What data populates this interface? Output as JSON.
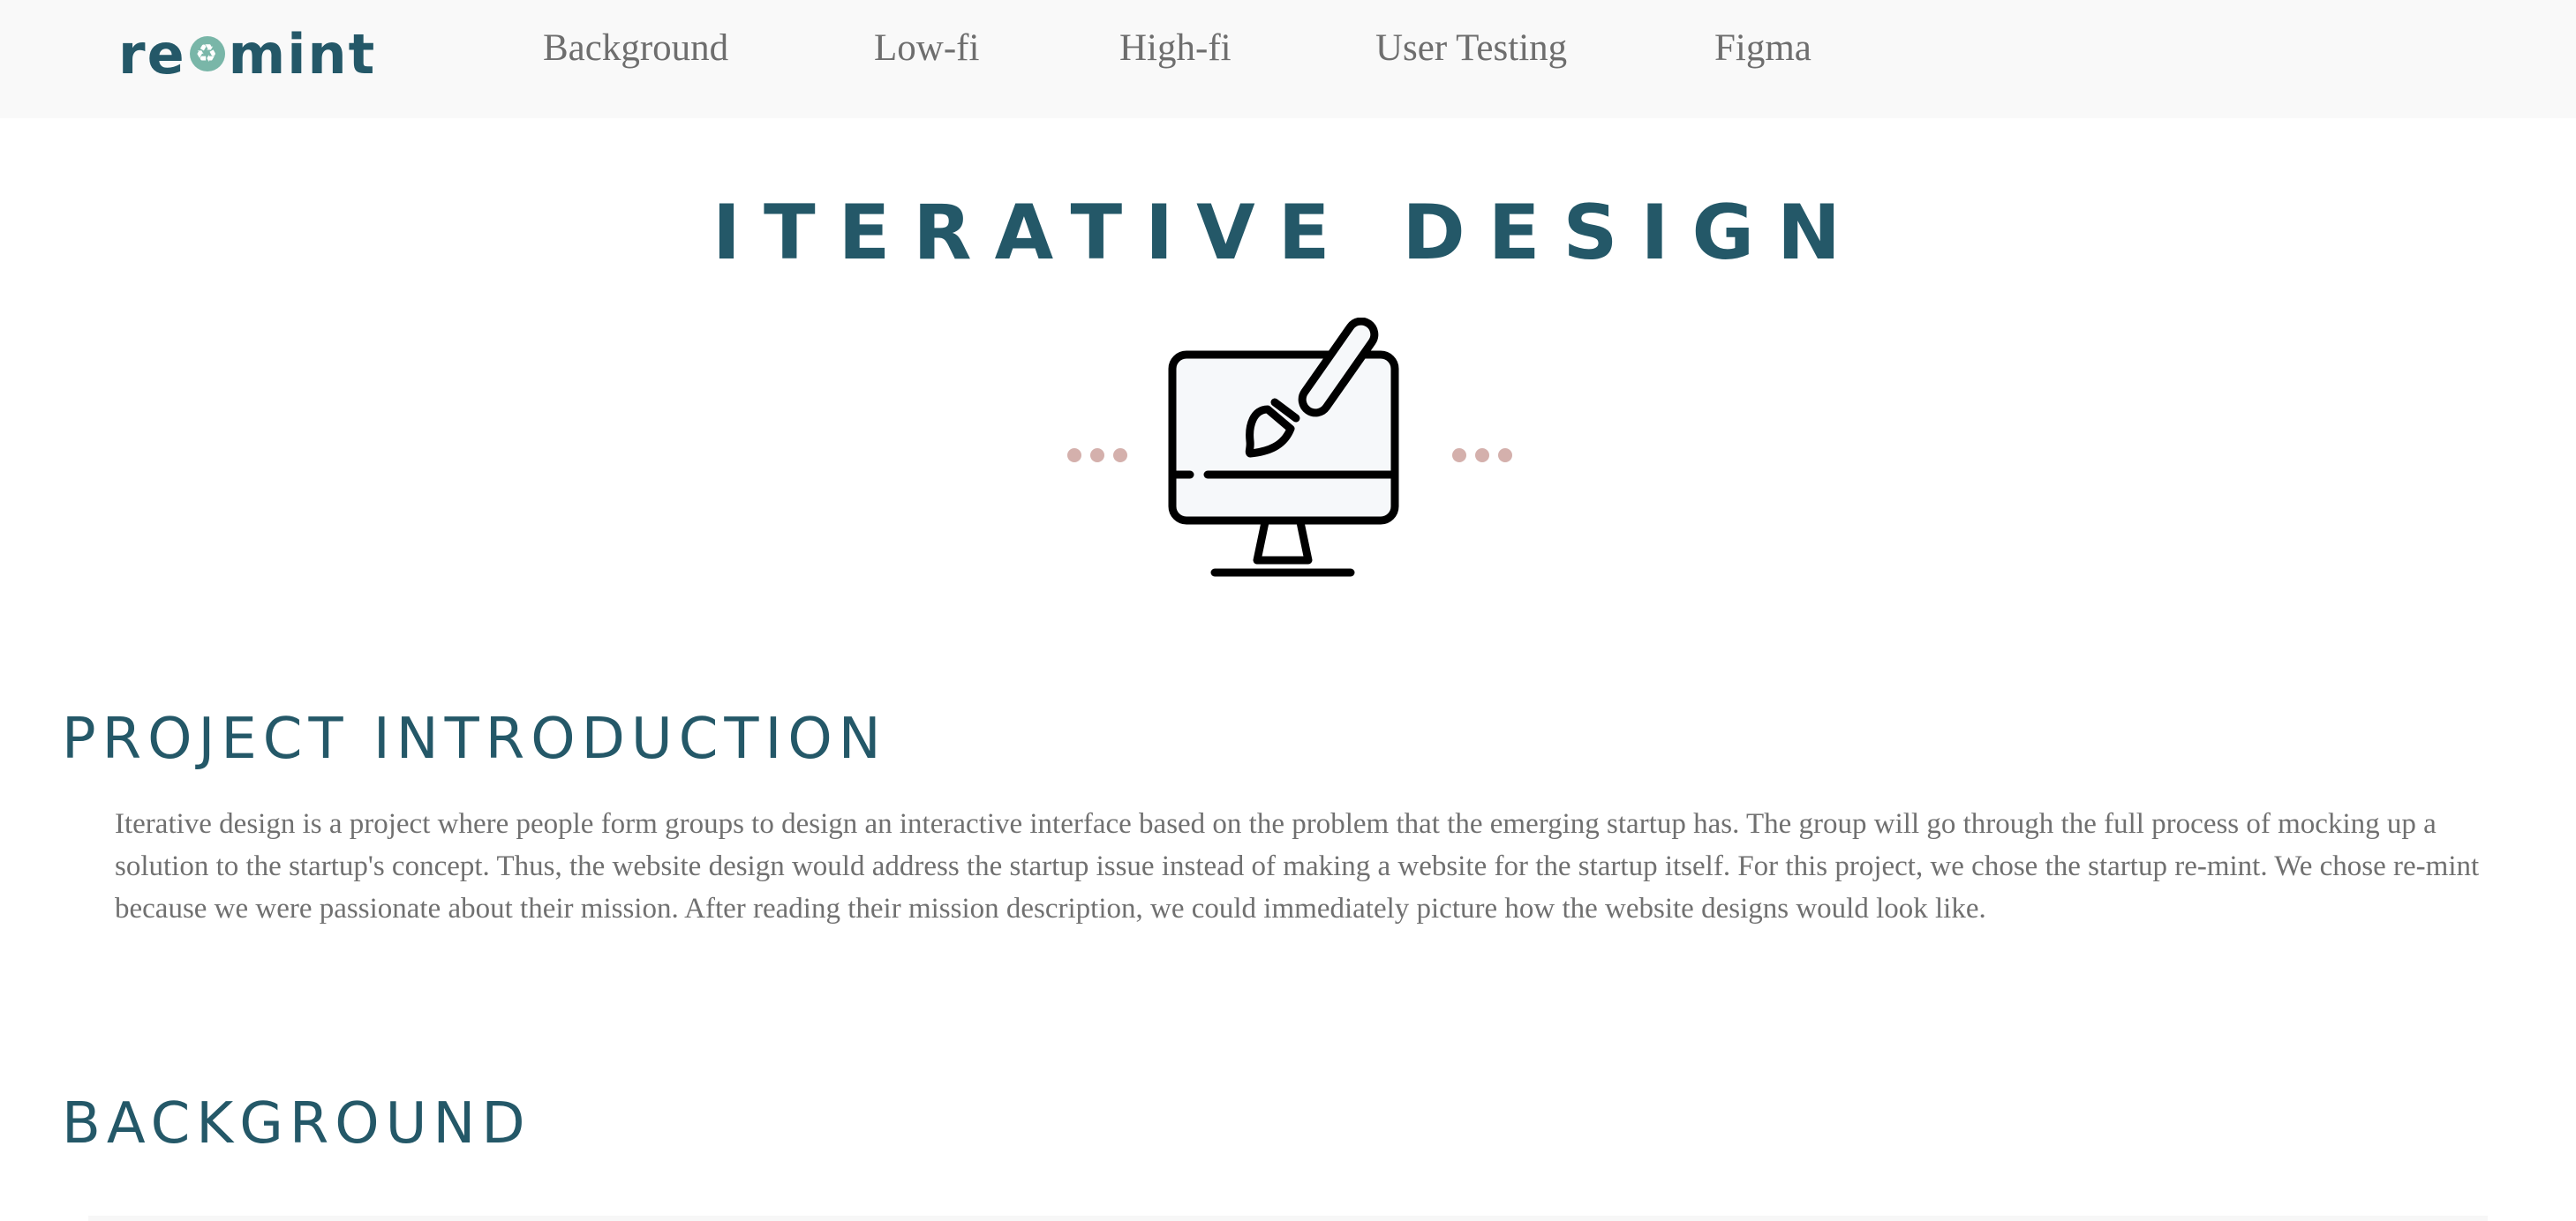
{
  "nav": {
    "logo": {
      "left": "re",
      "right": "mint",
      "icon": "recycle-icon"
    },
    "links": [
      "Background",
      "Low-fi",
      "High-fi",
      "User Testing",
      "Figma"
    ]
  },
  "hero": {
    "title": "ITERATIVE DESIGN",
    "icon": "monitor-paintbrush-icon"
  },
  "sections": {
    "intro": {
      "heading": "PROJECT INTRODUCTION",
      "body": "Iterative design is a project where people form groups to design an interactive interface based on the problem that the emerging startup has. The group will go through the full process of mocking up a solution to the startup's concept. Thus, the website design would address the startup issue instead of making a website for the startup itself. For this project, we chose the startup re-mint. We chose re-mint because we were passionate about their mission. After reading their mission description, we could immediately picture how the website designs would look like."
    },
    "background": {
      "heading": "BACKGROUND"
    }
  },
  "colors": {
    "accent": "#245868",
    "nav_bg": "#f9f9f9",
    "body_text": "#707070",
    "dots": "#d4b0ac",
    "logo_icon": "#79b6a8"
  }
}
